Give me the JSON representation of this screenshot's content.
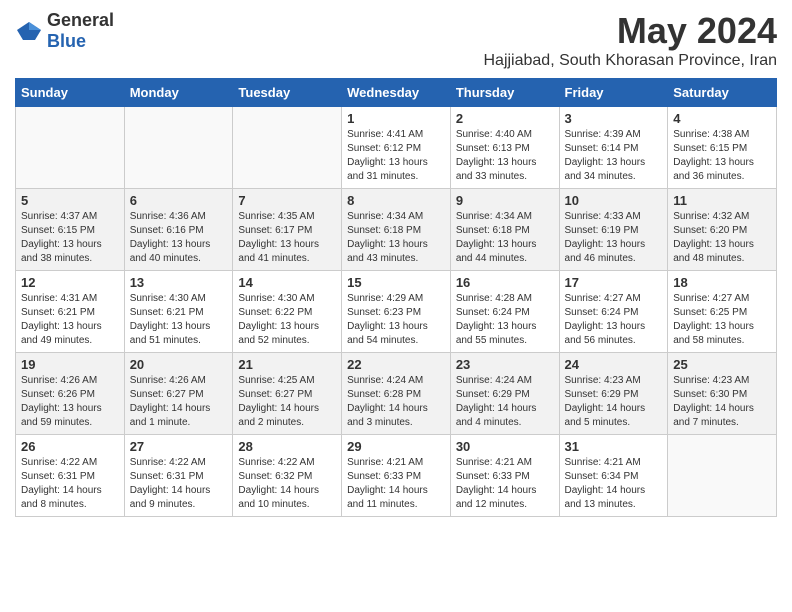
{
  "logo": {
    "general": "General",
    "blue": "Blue"
  },
  "title": {
    "month_year": "May 2024",
    "location": "Hajjiabad, South Khorasan Province, Iran"
  },
  "weekdays": [
    "Sunday",
    "Monday",
    "Tuesday",
    "Wednesday",
    "Thursday",
    "Friday",
    "Saturday"
  ],
  "weeks": [
    [
      {
        "day": "",
        "info": ""
      },
      {
        "day": "",
        "info": ""
      },
      {
        "day": "",
        "info": ""
      },
      {
        "day": "1",
        "info": "Sunrise: 4:41 AM\nSunset: 6:12 PM\nDaylight: 13 hours\nand 31 minutes."
      },
      {
        "day": "2",
        "info": "Sunrise: 4:40 AM\nSunset: 6:13 PM\nDaylight: 13 hours\nand 33 minutes."
      },
      {
        "day": "3",
        "info": "Sunrise: 4:39 AM\nSunset: 6:14 PM\nDaylight: 13 hours\nand 34 minutes."
      },
      {
        "day": "4",
        "info": "Sunrise: 4:38 AM\nSunset: 6:15 PM\nDaylight: 13 hours\nand 36 minutes."
      }
    ],
    [
      {
        "day": "5",
        "info": "Sunrise: 4:37 AM\nSunset: 6:15 PM\nDaylight: 13 hours\nand 38 minutes."
      },
      {
        "day": "6",
        "info": "Sunrise: 4:36 AM\nSunset: 6:16 PM\nDaylight: 13 hours\nand 40 minutes."
      },
      {
        "day": "7",
        "info": "Sunrise: 4:35 AM\nSunset: 6:17 PM\nDaylight: 13 hours\nand 41 minutes."
      },
      {
        "day": "8",
        "info": "Sunrise: 4:34 AM\nSunset: 6:18 PM\nDaylight: 13 hours\nand 43 minutes."
      },
      {
        "day": "9",
        "info": "Sunrise: 4:34 AM\nSunset: 6:18 PM\nDaylight: 13 hours\nand 44 minutes."
      },
      {
        "day": "10",
        "info": "Sunrise: 4:33 AM\nSunset: 6:19 PM\nDaylight: 13 hours\nand 46 minutes."
      },
      {
        "day": "11",
        "info": "Sunrise: 4:32 AM\nSunset: 6:20 PM\nDaylight: 13 hours\nand 48 minutes."
      }
    ],
    [
      {
        "day": "12",
        "info": "Sunrise: 4:31 AM\nSunset: 6:21 PM\nDaylight: 13 hours\nand 49 minutes."
      },
      {
        "day": "13",
        "info": "Sunrise: 4:30 AM\nSunset: 6:21 PM\nDaylight: 13 hours\nand 51 minutes."
      },
      {
        "day": "14",
        "info": "Sunrise: 4:30 AM\nSunset: 6:22 PM\nDaylight: 13 hours\nand 52 minutes."
      },
      {
        "day": "15",
        "info": "Sunrise: 4:29 AM\nSunset: 6:23 PM\nDaylight: 13 hours\nand 54 minutes."
      },
      {
        "day": "16",
        "info": "Sunrise: 4:28 AM\nSunset: 6:24 PM\nDaylight: 13 hours\nand 55 minutes."
      },
      {
        "day": "17",
        "info": "Sunrise: 4:27 AM\nSunset: 6:24 PM\nDaylight: 13 hours\nand 56 minutes."
      },
      {
        "day": "18",
        "info": "Sunrise: 4:27 AM\nSunset: 6:25 PM\nDaylight: 13 hours\nand 58 minutes."
      }
    ],
    [
      {
        "day": "19",
        "info": "Sunrise: 4:26 AM\nSunset: 6:26 PM\nDaylight: 13 hours\nand 59 minutes."
      },
      {
        "day": "20",
        "info": "Sunrise: 4:26 AM\nSunset: 6:27 PM\nDaylight: 14 hours\nand 1 minute."
      },
      {
        "day": "21",
        "info": "Sunrise: 4:25 AM\nSunset: 6:27 PM\nDaylight: 14 hours\nand 2 minutes."
      },
      {
        "day": "22",
        "info": "Sunrise: 4:24 AM\nSunset: 6:28 PM\nDaylight: 14 hours\nand 3 minutes."
      },
      {
        "day": "23",
        "info": "Sunrise: 4:24 AM\nSunset: 6:29 PM\nDaylight: 14 hours\nand 4 minutes."
      },
      {
        "day": "24",
        "info": "Sunrise: 4:23 AM\nSunset: 6:29 PM\nDaylight: 14 hours\nand 5 minutes."
      },
      {
        "day": "25",
        "info": "Sunrise: 4:23 AM\nSunset: 6:30 PM\nDaylight: 14 hours\nand 7 minutes."
      }
    ],
    [
      {
        "day": "26",
        "info": "Sunrise: 4:22 AM\nSunset: 6:31 PM\nDaylight: 14 hours\nand 8 minutes."
      },
      {
        "day": "27",
        "info": "Sunrise: 4:22 AM\nSunset: 6:31 PM\nDaylight: 14 hours\nand 9 minutes."
      },
      {
        "day": "28",
        "info": "Sunrise: 4:22 AM\nSunset: 6:32 PM\nDaylight: 14 hours\nand 10 minutes."
      },
      {
        "day": "29",
        "info": "Sunrise: 4:21 AM\nSunset: 6:33 PM\nDaylight: 14 hours\nand 11 minutes."
      },
      {
        "day": "30",
        "info": "Sunrise: 4:21 AM\nSunset: 6:33 PM\nDaylight: 14 hours\nand 12 minutes."
      },
      {
        "day": "31",
        "info": "Sunrise: 4:21 AM\nSunset: 6:34 PM\nDaylight: 14 hours\nand 13 minutes."
      },
      {
        "day": "",
        "info": ""
      }
    ]
  ]
}
